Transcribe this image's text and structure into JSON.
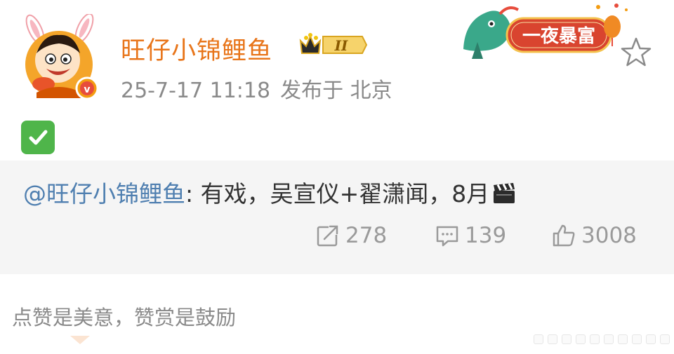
{
  "post": {
    "author": "旺仔小锦鲤鱼",
    "vip_level": "II",
    "timestamp": "25-7-17 11:18",
    "location": "发布于 北京",
    "verified_icon": "v-verified-icon",
    "content_emoji": "check-mark-button-emoji",
    "banner_text": "一夜暴富"
  },
  "retweet": {
    "mention": "@旺仔小锦鲤鱼",
    "text": ": 有戏，吴宣仪+翟潇闻，8月",
    "emoji": "clapper-board-emoji",
    "stats": {
      "forward": "278",
      "comment": "139",
      "like": "3008"
    }
  },
  "footer": {
    "reward_text": "点赞是美意，赞赏是鼓励"
  },
  "colors": {
    "username": "#e8751a",
    "mention": "#4f7fb0",
    "meta": "#8a8a8a",
    "retweet_bg": "#f5f5f5"
  }
}
